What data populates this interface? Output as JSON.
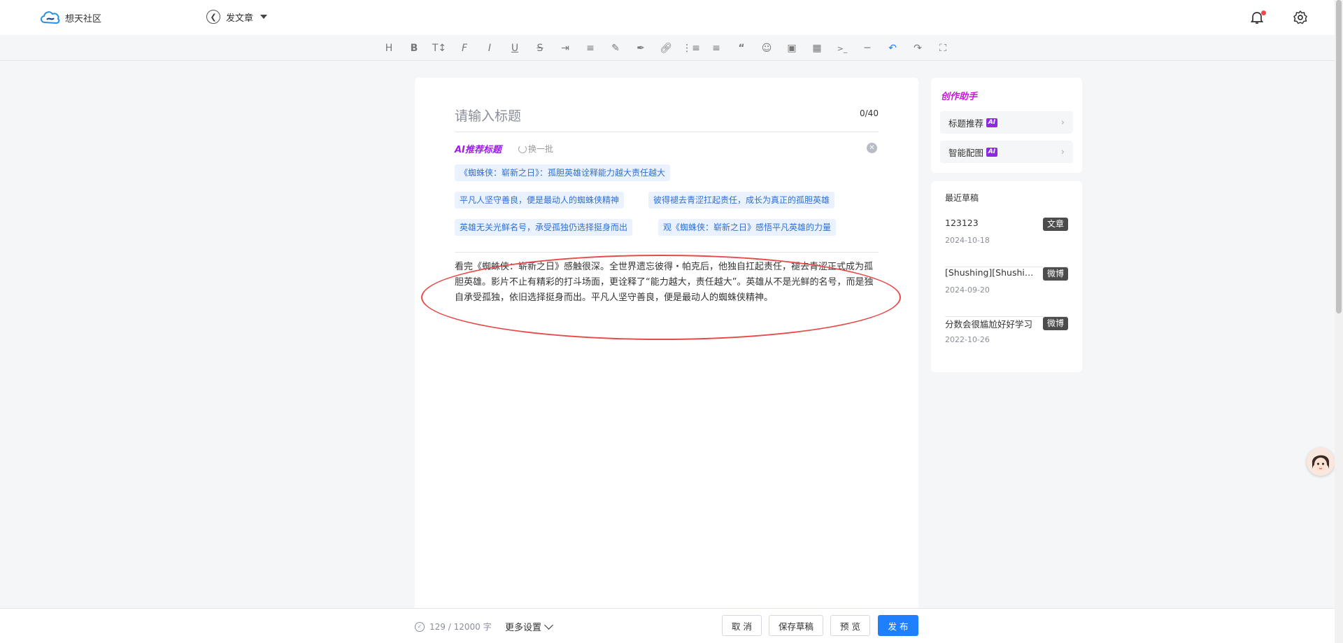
{
  "header": {
    "logo_text": "想天社区",
    "back_label": "发文章"
  },
  "toolbar": {
    "icons": [
      "heading-icon",
      "bold-icon",
      "font-size-icon",
      "font-family-icon",
      "italic-icon",
      "underline-icon",
      "strikethrough-icon",
      "indent-icon",
      "align-icon",
      "highlight-icon",
      "brush-icon",
      "link-icon",
      "bullet-list-icon",
      "ordered-list-icon",
      "quote-icon",
      "emoji-icon",
      "image-icon",
      "table-icon",
      "code-icon",
      "hr-icon",
      "undo-icon",
      "redo-icon",
      "fullscreen-icon"
    ]
  },
  "editor": {
    "title_placeholder": "请输入标题",
    "title_count": "0/40",
    "ai_label": "AI推荐标题",
    "refresh_label": "换一批",
    "suggestions": [
      "《蜘蛛侠：崭新之日》：孤胆英雄诠释能力越大责任越大",
      "平凡人坚守善良，便是最动人的蜘蛛侠精神",
      "彼得褪去青涩扛起责任，成长为真正的孤胆英雄",
      "英雄无关光鲜名号，承受孤独仍选择挺身而出",
      "观《蜘蛛侠：崭新之日》感悟平凡英雄的力量"
    ],
    "body": "看完《蜘蛛侠：崭新之日》感触很深。全世界遗忘彼得・帕克后，他独自扛起责任，褪去青涩正式成为孤胆英雄。影片不止有精彩的打斗场面，更诠释了“能力越大，责任越大”。英雄从不是光鲜的名号，而是独自承受孤独，依旧选择挺身而出。平凡人坚守善良，便是最动人的蜘蛛侠精神。"
  },
  "assistant": {
    "title": "创作助手",
    "items": [
      {
        "label": "标题推荐",
        "badge": "AI"
      },
      {
        "label": "智能配图",
        "badge": "AI"
      }
    ]
  },
  "drafts": {
    "title": "最近草稿",
    "items": [
      {
        "name": "123123",
        "tag": "文章",
        "date": "2024-10-18"
      },
      {
        "name": "[Shushing][Shushing]",
        "tag": "微博",
        "date": "2024-09-20"
      },
      {
        "name": "分数会很尴尬好好学习",
        "tag": "微博",
        "date": "2022-10-26"
      }
    ]
  },
  "footer": {
    "word_count": "129 / 12000 字",
    "more_settings": "更多设置",
    "cancel": "取 消",
    "save_draft": "保存草稿",
    "preview": "预 览",
    "publish": "发 布"
  },
  "colors": {
    "accent": "#1e80ff",
    "annotation": "#e84a4a",
    "ai_purple": "#9b1fe8"
  }
}
